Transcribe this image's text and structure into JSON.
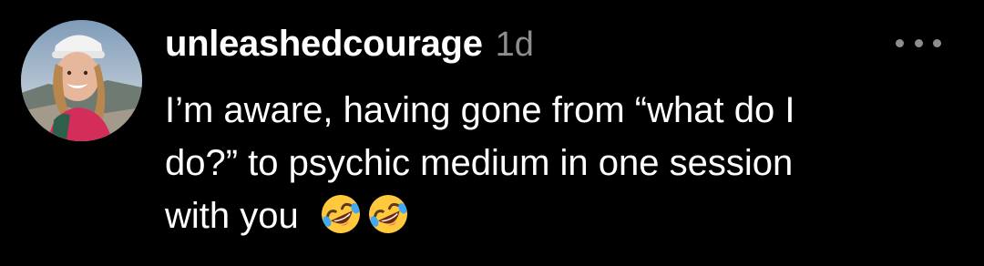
{
  "comment": {
    "username": "unleashedcourage",
    "timestamp": "1d",
    "lines": [
      "I’m aware, having gone from “what do I",
      "do?” to psychic medium in one session",
      "with you"
    ],
    "emojis": [
      "rolling-on-floor-laughing-emoji",
      "rolling-on-floor-laughing-emoji"
    ],
    "more_icon": "more-horizontal-icon"
  },
  "colors": {
    "background": "#000000",
    "text": "#ffffff",
    "muted": "#8e8e8e"
  }
}
